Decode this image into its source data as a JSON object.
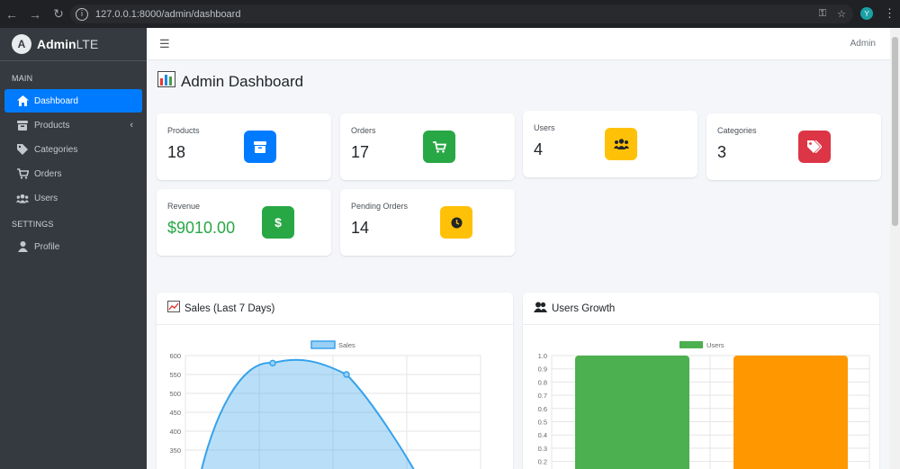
{
  "browser": {
    "url": "127.0.0.1:8000/admin/dashboard",
    "profile_initial": "Y"
  },
  "sidebar": {
    "brand_bold": "Admin",
    "brand_light": "LTE",
    "sections": [
      {
        "header": "MAIN"
      },
      {
        "header": "SETTINGS"
      }
    ],
    "items": [
      {
        "label": "Dashboard",
        "icon": "home-icon"
      },
      {
        "label": "Products",
        "icon": "box-icon"
      },
      {
        "label": "Categories",
        "icon": "tags-icon"
      },
      {
        "label": "Orders",
        "icon": "cart-icon"
      },
      {
        "label": "Users",
        "icon": "users-icon"
      },
      {
        "label": "Profile",
        "icon": "user-icon"
      }
    ]
  },
  "topnav": {
    "user": "Admin"
  },
  "page": {
    "title": "Admin Dashboard"
  },
  "stats": [
    {
      "label": "Products",
      "value": "18",
      "color": "#007bff",
      "icon": "box-icon"
    },
    {
      "label": "Orders",
      "value": "17",
      "color": "#28a745",
      "icon": "cart-icon"
    },
    {
      "label": "Users",
      "value": "4",
      "color": "#ffc107",
      "icon": "users-icon"
    },
    {
      "label": "Categories",
      "value": "3",
      "color": "#dc3545",
      "icon": "tags-icon"
    },
    {
      "label": "Revenue",
      "value": "$9010.00",
      "color": "#28a745",
      "icon": "dollar-icon"
    },
    {
      "label": "Pending Orders",
      "value": "14",
      "color": "#ffc107",
      "icon": "clock-icon"
    }
  ],
  "panels": {
    "sales_title": "Sales (Last 7 Days)",
    "users_title": "Users Growth"
  },
  "chart_data": [
    {
      "type": "line",
      "legend": "Sales",
      "ylim": [
        300,
        600
      ],
      "y_ticks": [
        "600",
        "550",
        "500",
        "450",
        "400",
        "350"
      ],
      "points": [
        {
          "x": 0,
          "y": 280
        },
        {
          "x": 1,
          "y": 580
        },
        {
          "x": 2,
          "y": 550
        },
        {
          "x": 3,
          "y": 280
        }
      ],
      "color": "#36a2eb"
    },
    {
      "type": "bar",
      "legend": "Users",
      "ylim": [
        0.2,
        1.0
      ],
      "y_ticks": [
        "1.0",
        "0.9",
        "0.8",
        "0.7",
        "0.6",
        "0.5",
        "0.4",
        "0.3",
        "0.2"
      ],
      "values": [
        1,
        1
      ],
      "colors": [
        "#4caf50",
        "#ff9800"
      ],
      "legend_color": "#4caf50"
    }
  ]
}
